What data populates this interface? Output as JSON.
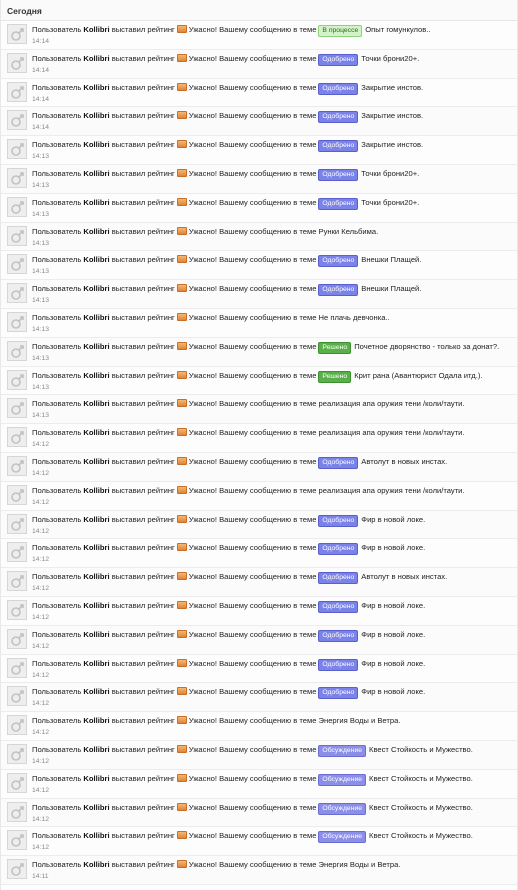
{
  "section": {
    "title": "Сегодня"
  },
  "template": {
    "prefix": "Пользователь",
    "action": "выставил рейтинг",
    "message": "Ужасно! Вашему сообщению в теме"
  },
  "colors": {
    "process": "#d3f2c8",
    "approved": "#7b83e8",
    "solved": "#58b048",
    "discuss": "#8c8fe8"
  },
  "items": [
    {
      "user": "Kollibri",
      "badge": "В процессе",
      "badge_type": "process",
      "topic": "Опыт гомункулов..",
      "time": "14:14"
    },
    {
      "user": "Kollibri",
      "badge": "Одобрено",
      "badge_type": "approved",
      "topic": "Точки брони20+.",
      "time": "14:14"
    },
    {
      "user": "Kollibri",
      "badge": "Одобрено",
      "badge_type": "approved",
      "topic": "Закрытие инстов.",
      "time": "14:14"
    },
    {
      "user": "Kollibri",
      "badge": "Одобрено",
      "badge_type": "approved",
      "topic": "Закрытие инстов.",
      "time": "14:14"
    },
    {
      "user": "Kollibri",
      "badge": "Одобрено",
      "badge_type": "approved",
      "topic": "Закрытие инстов.",
      "time": "14:13"
    },
    {
      "user": "Kollibri",
      "badge": "Одобрено",
      "badge_type": "approved",
      "topic": "Точки брони20+.",
      "time": "14:13"
    },
    {
      "user": "Kollibri",
      "badge": "Одобрено",
      "badge_type": "approved",
      "topic": "Точки брони20+.",
      "time": "14:13"
    },
    {
      "user": "Kollibri",
      "badge": "",
      "badge_type": "",
      "topic": "Рунки Кельбима.",
      "time": "14:13"
    },
    {
      "user": "Kollibri",
      "badge": "Одобрено",
      "badge_type": "approved",
      "topic": "Внешки Плащей.",
      "time": "14:13"
    },
    {
      "user": "Kollibri",
      "badge": "Одобрено",
      "badge_type": "approved",
      "topic": "Внешки Плащей.",
      "time": "14:13"
    },
    {
      "user": "Kollibri",
      "badge": "",
      "badge_type": "",
      "topic": "Не плачь девчонка..",
      "time": "14:13"
    },
    {
      "user": "Kollibri",
      "badge": "Решено",
      "badge_type": "solved",
      "topic": "Почетное дворянство - только за донат?.",
      "time": "14:13"
    },
    {
      "user": "Kollibri",
      "badge": "Решено",
      "badge_type": "solved",
      "topic": "Крит рана (Авантюрист Одала итд.).",
      "time": "14:13"
    },
    {
      "user": "Kollibri",
      "badge": "",
      "badge_type": "",
      "topic": "реализация апа оружия тени /коли/таути.",
      "time": "14:13"
    },
    {
      "user": "Kollibri",
      "badge": "",
      "badge_type": "",
      "topic": "реализация апа оружия тени /коли/таути.",
      "time": "14:12"
    },
    {
      "user": "Kollibri",
      "badge": "Одобрено",
      "badge_type": "approved",
      "topic": "Автолут в новых инстах.",
      "time": "14:12"
    },
    {
      "user": "Kollibri",
      "badge": "",
      "badge_type": "",
      "topic": "реализация апа оружия тени /коли/таути.",
      "time": "14:12"
    },
    {
      "user": "Kollibri",
      "badge": "Одобрено",
      "badge_type": "approved",
      "topic": "Фир в новой локе.",
      "time": "14:12"
    },
    {
      "user": "Kollibri",
      "badge": "Одобрено",
      "badge_type": "approved",
      "topic": "Фир в новой локе.",
      "time": "14:12"
    },
    {
      "user": "Kollibri",
      "badge": "Одобрено",
      "badge_type": "approved",
      "topic": "Автолут в новых инстах.",
      "time": "14:12"
    },
    {
      "user": "Kollibri",
      "badge": "Одобрено",
      "badge_type": "approved",
      "topic": "Фир в новой локе.",
      "time": "14:12"
    },
    {
      "user": "Kollibri",
      "badge": "Одобрено",
      "badge_type": "approved",
      "topic": "Фир в новой локе.",
      "time": "14:12"
    },
    {
      "user": "Kollibri",
      "badge": "Одобрено",
      "badge_type": "approved",
      "topic": "Фир в новой локе.",
      "time": "14:12"
    },
    {
      "user": "Kollibri",
      "badge": "Одобрено",
      "badge_type": "approved",
      "topic": "Фир в новой локе.",
      "time": "14:12"
    },
    {
      "user": "Kollibri",
      "badge": "",
      "badge_type": "",
      "topic": "Энергия Воды и Ветра.",
      "time": "14:12"
    },
    {
      "user": "Kollibri",
      "badge": "Обсуждение",
      "badge_type": "discuss",
      "topic": "Квест Стойкость и Мужество.",
      "time": "14:12"
    },
    {
      "user": "Kollibri",
      "badge": "Обсуждение",
      "badge_type": "discuss",
      "topic": "Квест Стойкость и Мужество.",
      "time": "14:12"
    },
    {
      "user": "Kollibri",
      "badge": "Обсуждение",
      "badge_type": "discuss",
      "topic": "Квест Стойкость и Мужество.",
      "time": "14:12"
    },
    {
      "user": "Kollibri",
      "badge": "Обсуждение",
      "badge_type": "discuss",
      "topic": "Квест Стойкость и Мужество.",
      "time": "14:12"
    },
    {
      "user": "Kollibri",
      "badge": "",
      "badge_type": "",
      "topic": "Энергия Воды и Ветра.",
      "time": "14:11"
    }
  ]
}
